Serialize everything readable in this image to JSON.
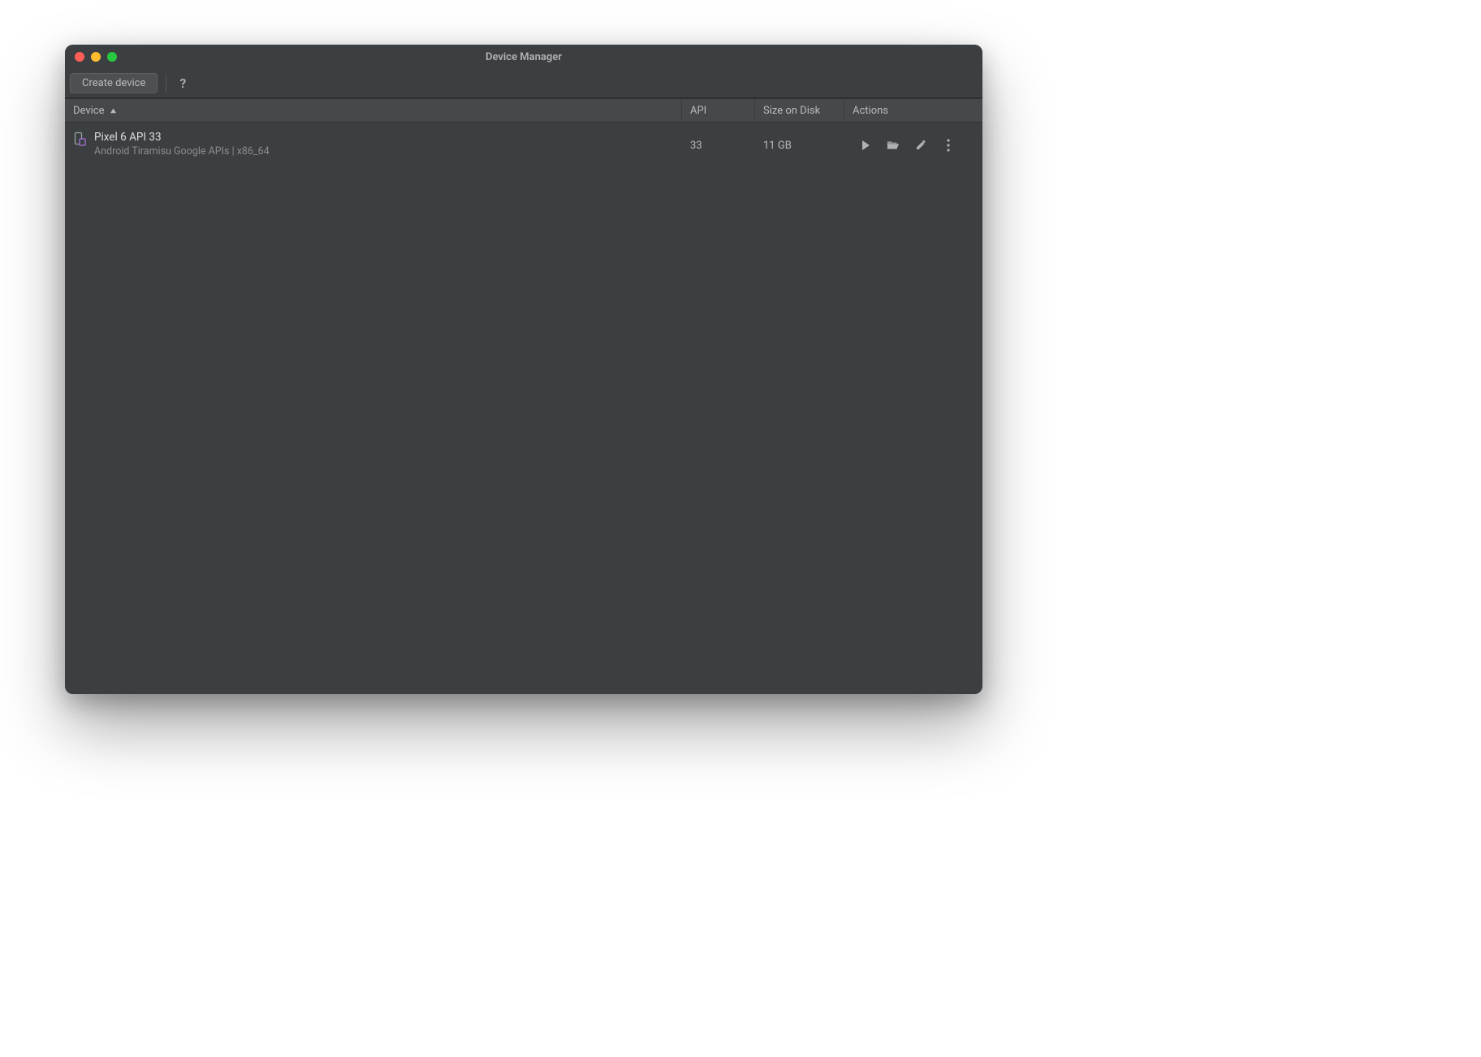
{
  "window": {
    "title": "Device Manager"
  },
  "toolbar": {
    "create_label": "Create device",
    "help_glyph": "?"
  },
  "table": {
    "headers": {
      "device": "Device",
      "api": "API",
      "size": "Size on Disk",
      "actions": "Actions"
    },
    "rows": [
      {
        "name": "Pixel 6 API 33",
        "subtitle": "Android Tiramisu Google APIs | x86_64",
        "api": "33",
        "size": "11 GB"
      }
    ]
  }
}
